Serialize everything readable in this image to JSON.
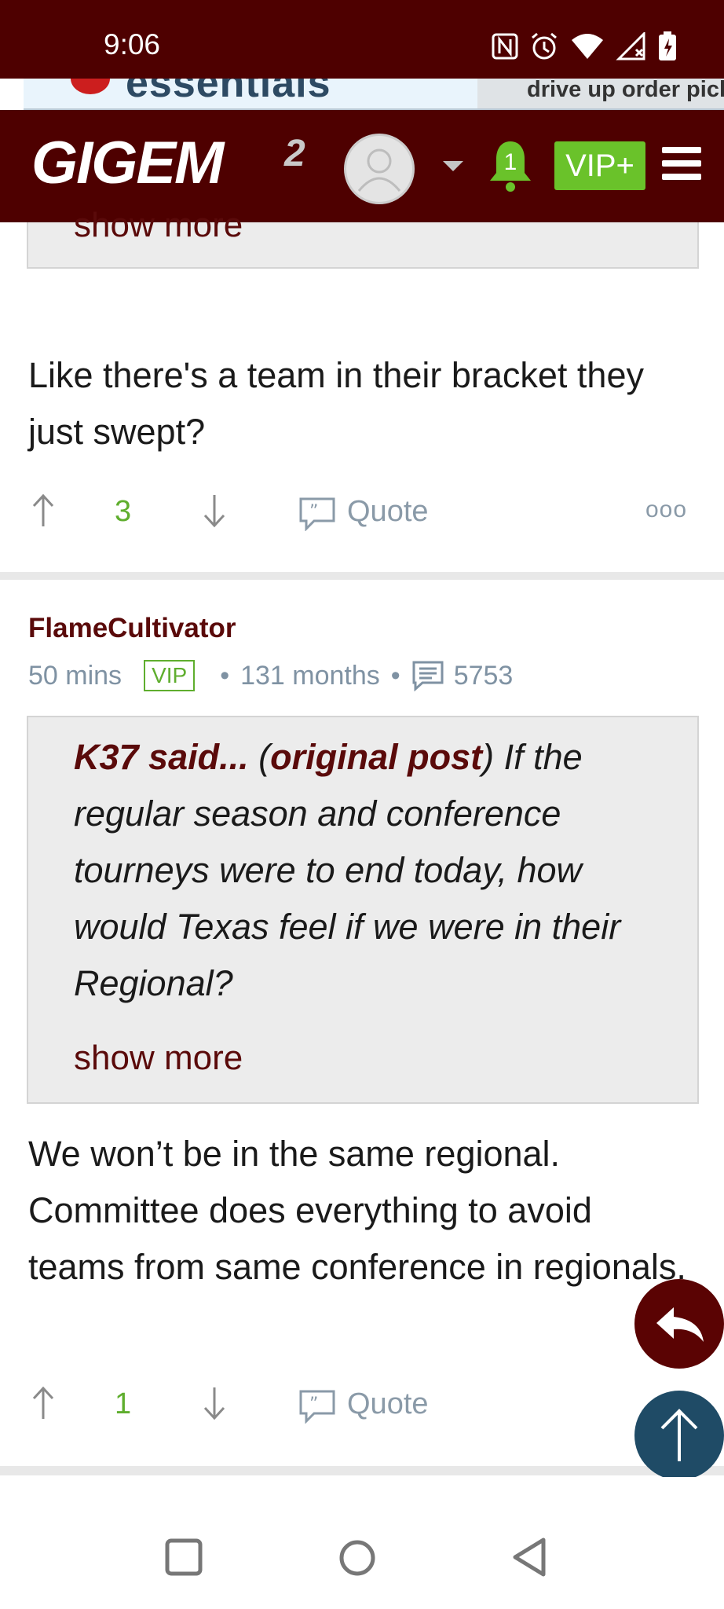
{
  "status_bar": {
    "time": "9:06"
  },
  "ad": {
    "left_text": "essentials",
    "right_text": "drive up  order pickup"
  },
  "header": {
    "logo": "GIGEM",
    "logo_sup": "2",
    "notification_count": "1",
    "vip_label": "VIP+"
  },
  "post1": {
    "show_more": "show more",
    "body": "Like there's a team in their bracket they just swept?",
    "upvotes": "3",
    "quote_label": "Quote",
    "more": "ooo"
  },
  "post2": {
    "author": "FlameCultivator",
    "time": "50 mins",
    "badge": "VIP",
    "tenure": "131 months",
    "post_count": "5753",
    "quote_author": "K37 said...",
    "quote_open": "(",
    "quote_link": "original post",
    "quote_close": ")",
    "quote_text": "If the regular season and conference tourneys were to end today, how would Texas feel if we were in their Regional?",
    "show_more": "show more",
    "body": "We won’t be in the same regional. Committee does everything to avoid teams from same conference in regionals.",
    "upvotes": "1",
    "quote_label": "Quote"
  },
  "colors": {
    "maroon": "#4e0000",
    "accent_green": "#6ac22a",
    "fab_blue": "#1f4b66"
  }
}
